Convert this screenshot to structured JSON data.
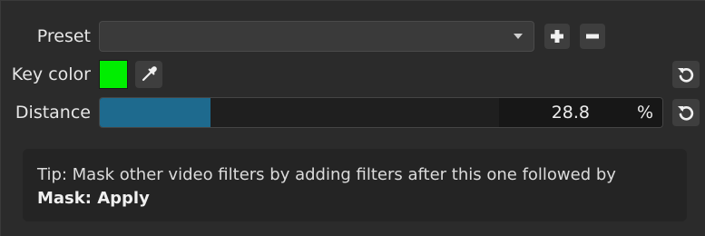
{
  "preset": {
    "label": "Preset",
    "selected": "",
    "add_icon": "plus-icon",
    "remove_icon": "minus-icon"
  },
  "key_color": {
    "label": "Key color",
    "color": "#00ee00",
    "picker_icon": "eyedropper-icon",
    "reset_icon": "undo-icon"
  },
  "distance": {
    "label": "Distance",
    "value": "28.8",
    "unit": "%",
    "fraction": 0.288,
    "fill_color": "#1e6a8e",
    "reset_icon": "undo-icon"
  },
  "tip": {
    "text": "Tip: Mask other video filters by adding filters after this one followed by",
    "bold": "Mask: Apply"
  }
}
